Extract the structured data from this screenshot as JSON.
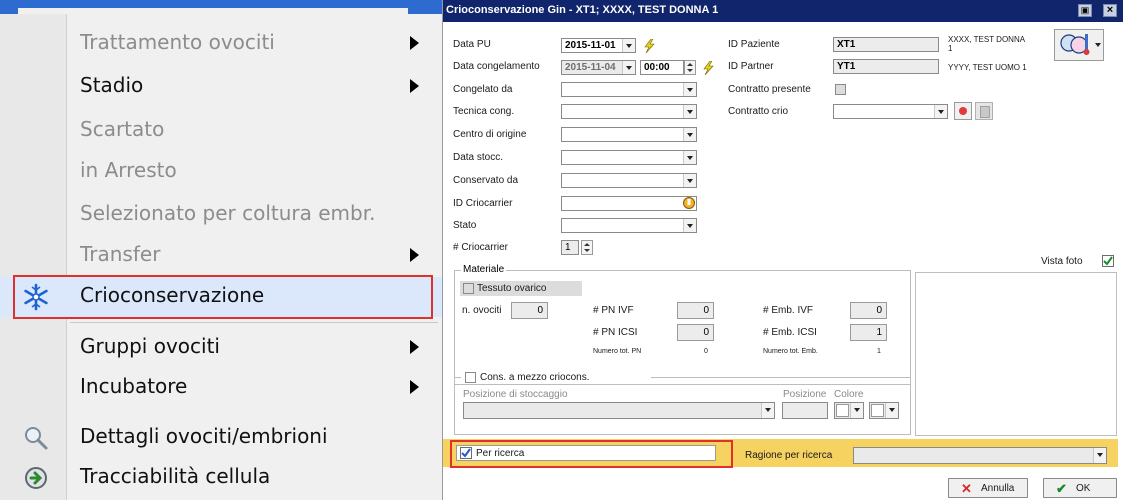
{
  "menu": {
    "items": [
      {
        "label": "Trattamento ovociti",
        "disabled": true,
        "submenu": true
      },
      {
        "label": "Stadio",
        "disabled": false,
        "submenu": true
      },
      {
        "label": "Scartato",
        "disabled": true,
        "submenu": false
      },
      {
        "label": "in Arresto",
        "disabled": true,
        "submenu": false
      },
      {
        "label": "Selezionato per coltura embr.",
        "disabled": true,
        "submenu": false
      },
      {
        "label": "Transfer",
        "disabled": true,
        "submenu": true
      },
      {
        "label": "Crioconservazione",
        "disabled": false,
        "submenu": false,
        "icon": "snowflake-icon",
        "highlighted": true
      },
      {
        "label": "Gruppi ovociti",
        "disabled": false,
        "submenu": true
      },
      {
        "label": "Incubatore",
        "disabled": false,
        "submenu": true
      },
      {
        "label": "Dettagli ovociti/embrioni",
        "disabled": false,
        "submenu": false,
        "icon": "magnifier-icon"
      },
      {
        "label": "Tracciabilità cellula",
        "disabled": false,
        "submenu": false,
        "icon": "refresh-arrow-icon"
      }
    ]
  },
  "dialog": {
    "title": "Crioconservazione Gin  - XT1; XXXX, TEST DONNA 1",
    "data_pu_label": "Data PU",
    "data_pu_value": "2015-11-01",
    "data_cong_label": "Data congelamento",
    "data_cong_value": "2015-11-04",
    "data_cong_time": "00:00",
    "congelato_da_label": "Congelato da",
    "tecnica_label": "Tecnica cong.",
    "centro_label": "Centro di origine",
    "data_stocc_label": "Data stocc.",
    "conservato_label": "Conservato da",
    "id_criocarrier_label": "ID Criocarrier",
    "stato_label": "Stato",
    "num_criocarrier_label": "# Criocarrier",
    "num_criocarrier_value": "1",
    "id_paziente_label": "ID Paziente",
    "id_paziente_value": "XT1",
    "paziente_name": "XXXX, TEST DONNA",
    "paziente_name2": "1",
    "id_partner_label": "ID Partner",
    "id_partner_value": "YT1",
    "partner_name": "YYYY, TEST UOMO 1",
    "contratto_presente_label": "Contratto presente",
    "contratto_crio_label": "Contratto crio",
    "vista_foto_label": "Vista foto",
    "materiale": {
      "title": "Materiale",
      "tessuto_label": "Tessuto ovarico",
      "n_ovociti_label": "n. ovociti",
      "n_ovociti_value": "0",
      "pn_ivf_label": "# PN IVF",
      "pn_ivf_value": "0",
      "pn_icsi_label": "# PN ICSI",
      "pn_icsi_value": "0",
      "emb_ivf_label": "# Emb. IVF",
      "emb_ivf_value": "0",
      "emb_icsi_label": "# Emb. ICSI",
      "emb_icsi_value": "1",
      "tot_pn_label": "Numero tot. PN",
      "tot_pn_value": "0",
      "tot_emb_label": "Numero tot. Emb.",
      "tot_emb_value": "1"
    },
    "cons": {
      "title": "Cons. a mezzo criocons.",
      "posizione_stoccaggio_label": "Posizione di stoccaggio",
      "posizione_label": "Posizione",
      "colore_label": "Colore"
    },
    "per_ricerca_label": "Per ricerca",
    "ragione_label": "Ragione per ricerca",
    "annulla_label": "Annulla",
    "ok_label": "OK"
  }
}
